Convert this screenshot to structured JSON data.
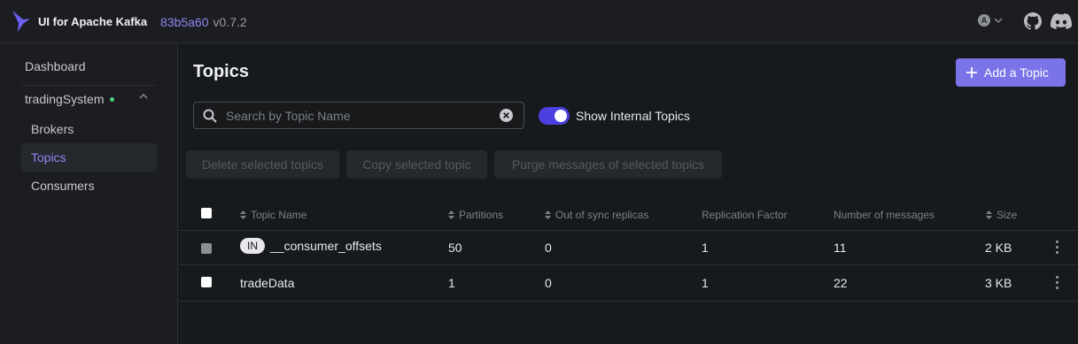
{
  "header": {
    "title": "UI for Apache Kafka",
    "version_hash": "83b5a60",
    "version": "v0.7.2",
    "user_initial": "A"
  },
  "sidebar": {
    "dashboard": "Dashboard",
    "cluster": "tradingSystem",
    "items": [
      {
        "label": "Brokers"
      },
      {
        "label": "Topics"
      },
      {
        "label": "Consumers"
      }
    ]
  },
  "page": {
    "title": "Topics",
    "add_button": "Add a Topic",
    "search_placeholder": "Search by Topic Name",
    "search_value": "",
    "show_internal_label": "Show Internal Topics",
    "show_internal": true,
    "bulk_actions": [
      "Delete selected topics",
      "Copy selected topic",
      "Purge messages of selected topics"
    ]
  },
  "table": {
    "columns": [
      "Topic Name",
      "Partitions",
      "Out of sync replicas",
      "Replication Factor",
      "Number of messages",
      "Size"
    ],
    "rows": [
      {
        "internal_badge": "IN",
        "name": "__consumer_offsets",
        "partitions": "50",
        "out_of_sync": "0",
        "replication": "1",
        "messages": "11",
        "size": "2 KB"
      },
      {
        "internal_badge": "",
        "name": "tradeData",
        "partitions": "1",
        "out_of_sync": "0",
        "replication": "1",
        "messages": "22",
        "size": "3 KB"
      }
    ]
  },
  "colors": {
    "accent": "#7b73e8",
    "toggle_on": "#4a41e0",
    "cluster_online": "#4cd07d",
    "background": "#171a1c"
  },
  "icons": [
    "kafka-logo-icon",
    "chevron-down-icon",
    "github-icon",
    "discord-icon",
    "chevron-up-icon",
    "plus-icon",
    "search-icon",
    "clear-icon",
    "sort-icon",
    "kebab-menu-icon"
  ]
}
